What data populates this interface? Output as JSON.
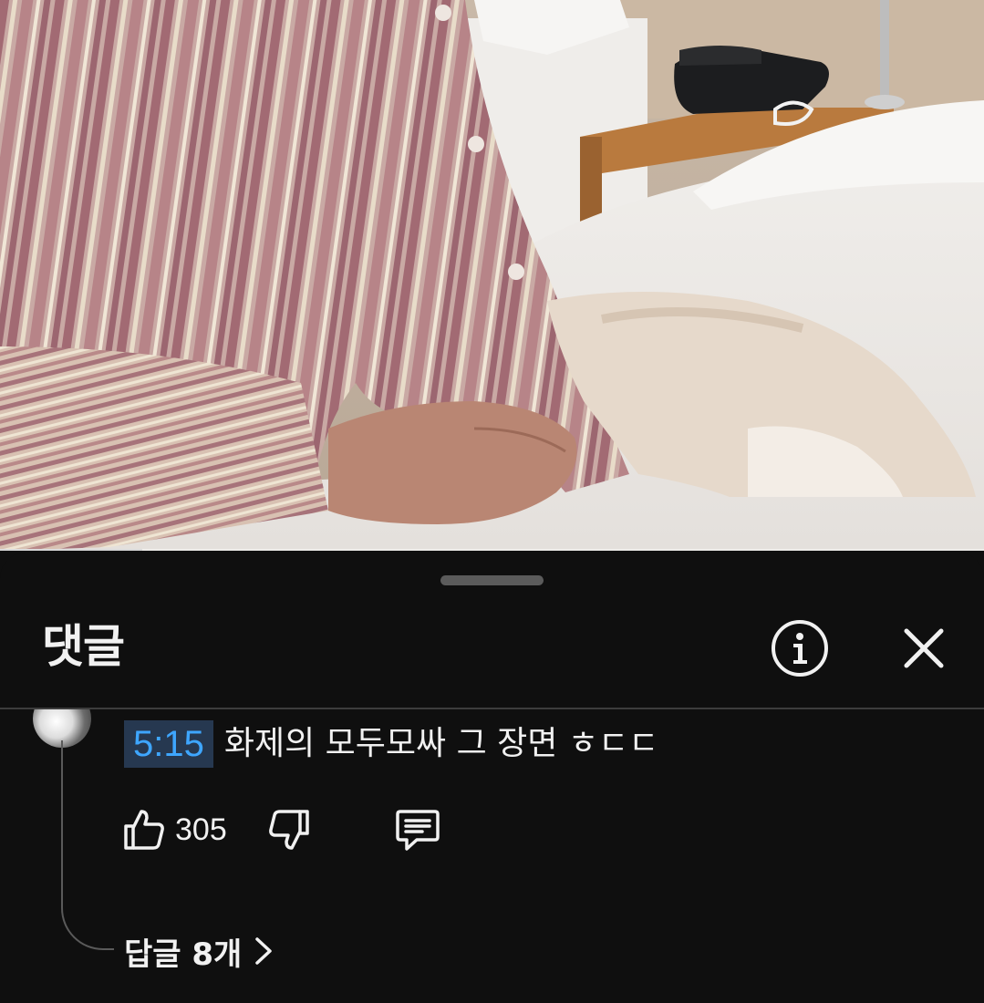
{
  "comments_panel": {
    "title": "댓글",
    "info_icon": "info-icon",
    "close_icon": "close-icon"
  },
  "video": {
    "progress_fraction": 0.145
  },
  "comment": {
    "timestamp": "5:15",
    "text": "화제의 모두모싸 그 장면 ㅎㄷㄷ",
    "like_count": "305",
    "replies_label": "답글 8개"
  },
  "colors": {
    "background": "#0f0f0f",
    "timestamp_text": "#3ea6ff",
    "timestamp_bg": "#263850"
  }
}
